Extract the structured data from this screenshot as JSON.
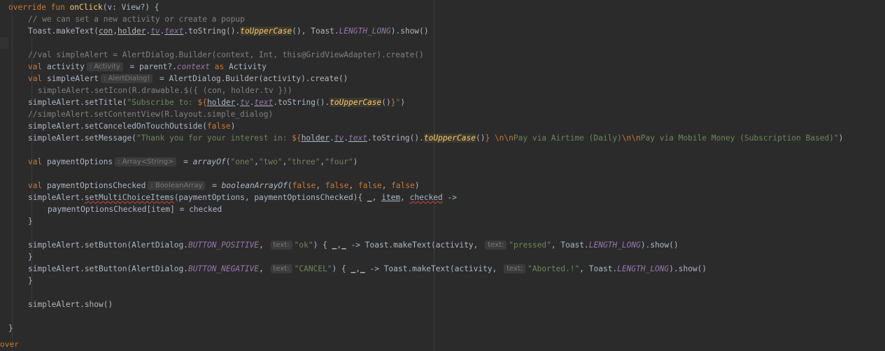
{
  "editor": {
    "lines": [
      {
        "indent": 0,
        "tokens": [
          {
            "t": "override fun ",
            "c": "kw"
          },
          {
            "t": "onClick",
            "c": "fn"
          },
          {
            "t": "(v: View?) {"
          }
        ]
      },
      {
        "indent": 1,
        "tokens": [
          {
            "t": "// we can set a new activity or create a popup",
            "c": "cmt"
          }
        ]
      },
      {
        "indent": 1,
        "tokens": [
          {
            "t": "Toast.makeText("
          },
          {
            "t": "con",
            "c": "u"
          },
          {
            "t": ","
          },
          {
            "t": "holder",
            "c": "u"
          },
          {
            "t": "."
          },
          {
            "t": "tv",
            "c": "u it"
          },
          {
            "t": "."
          },
          {
            "t": "text",
            "c": "u it"
          },
          {
            "t": ".toString()."
          },
          {
            "t": "toUpperCase",
            "c": "hl"
          },
          {
            "t": "(), Toast."
          },
          {
            "t": "LENGTH_LONG",
            "c": "it"
          },
          {
            "t": ").show()"
          }
        ]
      },
      {
        "indent": 0,
        "current": true,
        "tokens": []
      },
      {
        "indent": 1,
        "tokens": [
          {
            "t": "//val simpleAlert = AlertDialog.Builder(context, Int, this@GridViewAdapter).create()",
            "c": "cmt"
          }
        ]
      },
      {
        "indent": 1,
        "tokens": [
          {
            "t": "val ",
            "c": "kw"
          },
          {
            "t": "activity"
          },
          {
            "t": ": Activity",
            "c": "hint"
          },
          {
            "t": " = parent?."
          },
          {
            "t": "context",
            "c": "it"
          },
          {
            "t": " as ",
            "c": "kw"
          },
          {
            "t": "Activity"
          }
        ]
      },
      {
        "indent": 1,
        "tokens": [
          {
            "t": "val ",
            "c": "kw"
          },
          {
            "t": "simpleAlert"
          },
          {
            "t": ": AlertDialog!",
            "c": "hint"
          },
          {
            "t": " = AlertDialog.Builder(activity).create()"
          }
        ]
      },
      {
        "indent": 1,
        "extra": 2,
        "tokens": [
          {
            "t": "simpleAlert.setIcon(R.drawable.$({ (con, holder.tv }))",
            "c": "cmt"
          }
        ]
      },
      {
        "indent": 1,
        "tokens": [
          {
            "t": "simpleAlert.setTitle("
          },
          {
            "t": "\"Subscribe to: ",
            "c": "str"
          },
          {
            "t": "${",
            "c": "kw"
          },
          {
            "t": "holder",
            "c": "u"
          },
          {
            "t": "."
          },
          {
            "t": "tv",
            "c": "u it"
          },
          {
            "t": "."
          },
          {
            "t": "text",
            "c": "u it"
          },
          {
            "t": ".toString()."
          },
          {
            "t": "toUpperCase",
            "c": "hl"
          },
          {
            "t": "()"
          },
          {
            "t": "}",
            "c": "kw"
          },
          {
            "t": "\"",
            "c": "str"
          },
          {
            "t": ")"
          }
        ]
      },
      {
        "indent": 1,
        "tokens": [
          {
            "t": "//simpleAlert.setContentView(R.layout.simple_dialog)",
            "c": "cmt"
          }
        ]
      },
      {
        "indent": 1,
        "tokens": [
          {
            "t": "simpleAlert.setCanceledOnTouchOutside("
          },
          {
            "t": "false",
            "c": "kw"
          },
          {
            "t": ")"
          }
        ]
      },
      {
        "indent": 1,
        "tokens": [
          {
            "t": "simpleAlert.setMessage("
          },
          {
            "t": "\"Thank you for your interest in: ",
            "c": "str"
          },
          {
            "t": "${",
            "c": "kw"
          },
          {
            "t": "holder",
            "c": "u"
          },
          {
            "t": "."
          },
          {
            "t": "tv",
            "c": "u it"
          },
          {
            "t": "."
          },
          {
            "t": "text",
            "c": "u it"
          },
          {
            "t": ".toString()."
          },
          {
            "t": "toUpperCase",
            "c": "hl"
          },
          {
            "t": "()"
          },
          {
            "t": "}",
            "c": "kw"
          },
          {
            "t": " \\n\\n",
            "c": "kw"
          },
          {
            "t": "Pay via Airtime (Daily)",
            "c": "str"
          },
          {
            "t": "\\n\\n",
            "c": "kw"
          },
          {
            "t": "Pay via Mobile Money (Subscription Based)\"",
            "c": "str"
          },
          {
            "t": ")"
          }
        ]
      },
      {
        "indent": 0,
        "tokens": []
      },
      {
        "indent": 1,
        "tokens": [
          {
            "t": "val ",
            "c": "kw"
          },
          {
            "t": "paymentOptions"
          },
          {
            "t": ": Array<String>",
            "c": "hint"
          },
          {
            "t": " = "
          },
          {
            "t": "arrayOf",
            "c": "itf"
          },
          {
            "t": "("
          },
          {
            "t": "\"one\"",
            "c": "str"
          },
          {
            "t": ","
          },
          {
            "t": "\"two\"",
            "c": "str"
          },
          {
            "t": ","
          },
          {
            "t": "\"three\"",
            "c": "str"
          },
          {
            "t": ","
          },
          {
            "t": "\"four\"",
            "c": "str"
          },
          {
            "t": ")"
          }
        ]
      },
      {
        "indent": 0,
        "tokens": []
      },
      {
        "indent": 1,
        "tokens": [
          {
            "t": "val ",
            "c": "kw"
          },
          {
            "t": "paymentOptionsChecked"
          },
          {
            "t": ": BooleanArray",
            "c": "hint"
          },
          {
            "t": " = "
          },
          {
            "t": "booleanArrayOf",
            "c": "itf"
          },
          {
            "t": "("
          },
          {
            "t": "false",
            "c": "kw"
          },
          {
            "t": ", "
          },
          {
            "t": "false",
            "c": "kw"
          },
          {
            "t": ", "
          },
          {
            "t": "false",
            "c": "kw"
          },
          {
            "t": ", "
          },
          {
            "t": "false",
            "c": "kw"
          },
          {
            "t": ")"
          }
        ]
      },
      {
        "indent": 1,
        "tokens": [
          {
            "t": "simpleAlert."
          },
          {
            "t": "setMultiChoiceItems",
            "c": "err"
          },
          {
            "t": "(paymentOptions, paymentOptionsChecked){ "
          },
          {
            "t": "_",
            "c": "u"
          },
          {
            "t": ", "
          },
          {
            "t": "item",
            "c": "u"
          },
          {
            "t": ", "
          },
          {
            "t": "checked",
            "c": "u err"
          },
          {
            "t": " ->"
          }
        ]
      },
      {
        "indent": 2,
        "tokens": [
          {
            "t": "paymentOptionsChecked[item] = checked"
          }
        ]
      },
      {
        "indent": 1,
        "tokens": [
          {
            "t": "}"
          }
        ]
      },
      {
        "indent": 0,
        "tokens": []
      },
      {
        "indent": 1,
        "tokens": [
          {
            "t": "simpleAlert.setButton(AlertDialog."
          },
          {
            "t": "BUTTON_POSITIVE",
            "c": "it"
          },
          {
            "t": ", "
          },
          {
            "t": "text:",
            "c": "hint"
          },
          {
            "t": "\"ok\"",
            "c": "str"
          },
          {
            "t": ") { "
          },
          {
            "t": "_",
            "c": "u"
          },
          {
            "t": ","
          },
          {
            "t": "_",
            "c": "u"
          },
          {
            "t": " -> Toast.makeText(activity, "
          },
          {
            "t": "text:",
            "c": "hint"
          },
          {
            "t": "\"pressed\"",
            "c": "str"
          },
          {
            "t": ", Toast."
          },
          {
            "t": "LENGTH_LONG",
            "c": "it"
          },
          {
            "t": ").show()"
          }
        ]
      },
      {
        "indent": 1,
        "tokens": [
          {
            "t": "}"
          }
        ]
      },
      {
        "indent": 1,
        "tokens": [
          {
            "t": "simpleAlert.setButton(AlertDialog."
          },
          {
            "t": "BUTTON_NEGATIVE",
            "c": "it"
          },
          {
            "t": ", "
          },
          {
            "t": "text:",
            "c": "hint"
          },
          {
            "t": "\"CANCEL\"",
            "c": "str"
          },
          {
            "t": ") { "
          },
          {
            "t": "_",
            "c": "u"
          },
          {
            "t": ","
          },
          {
            "t": "_",
            "c": "u"
          },
          {
            "t": " -> Toast.makeText(activity, "
          },
          {
            "t": "text:",
            "c": "hint"
          },
          {
            "t": "\"Aborted.!\"",
            "c": "str"
          },
          {
            "t": ", Toast."
          },
          {
            "t": "LENGTH_LONG",
            "c": "it"
          },
          {
            "t": ").show()"
          }
        ]
      },
      {
        "indent": 1,
        "tokens": [
          {
            "t": "}"
          }
        ]
      },
      {
        "indent": 0,
        "tokens": []
      },
      {
        "indent": 1,
        "tokens": [
          {
            "t": "simpleAlert.show()"
          }
        ]
      },
      {
        "indent": 0,
        "tokens": []
      },
      {
        "indent": 0,
        "tokens": [
          {
            "t": "}"
          }
        ]
      }
    ],
    "bottom_partial": "over"
  },
  "colors": {
    "background": "#2b2b2b",
    "text": "#a9b7c6",
    "keyword": "#cc7832",
    "function": "#ffc66d",
    "string": "#6a8759",
    "comment": "#808080",
    "field": "#9876aa",
    "current_line": "#323232"
  }
}
